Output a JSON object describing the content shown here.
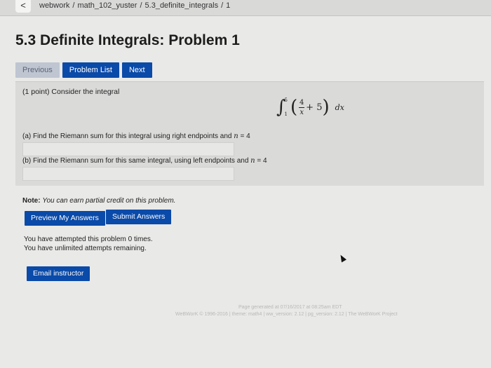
{
  "topbar": {
    "back_glyph": "<",
    "breadcrumb": [
      "webwork",
      "math_102_yuster",
      "5.3_definite_integrals",
      "1"
    ]
  },
  "page": {
    "title": "5.3 Definite Integrals: Problem 1"
  },
  "nav": {
    "previous": "Previous",
    "problem_list": "Problem List",
    "next": "Next"
  },
  "problem": {
    "intro": "(1 point) Consider the integral",
    "integral": {
      "symbol": "∫",
      "lower": "1",
      "upper": "5",
      "frac_num": "4",
      "frac_den": "x",
      "plus_term": "+ 5",
      "dx": "dx"
    },
    "part_a": {
      "text": "(a) Find the Riemann sum for this integral using right endpoints and",
      "var": "n",
      "eq": "= 4",
      "value": ""
    },
    "part_b": {
      "text": "(b) Find the Riemann sum for this same integral, using left endpoints and",
      "var": "n",
      "eq": "= 4",
      "value": ""
    }
  },
  "note": {
    "label": "Note:",
    "text": "You can earn partial credit on this problem."
  },
  "actions": {
    "preview": "Preview My Answers",
    "submit": "Submit Answers",
    "email": "Email instructor"
  },
  "attempts": {
    "line1": "You have attempted this problem 0 times.",
    "line2": "You have unlimited attempts remaining."
  },
  "footer": {
    "generated": "Page generated at 07/16/2017 at 08:25am EDT",
    "version": "WeBWorK © 1996-2016 | theme: math4 | ww_version: 2.12 | pg_version: 2.12 | The WeBWorK Project"
  },
  "colors": {
    "button_blue": "#0a4aa8",
    "background": "#e9e9e7"
  }
}
